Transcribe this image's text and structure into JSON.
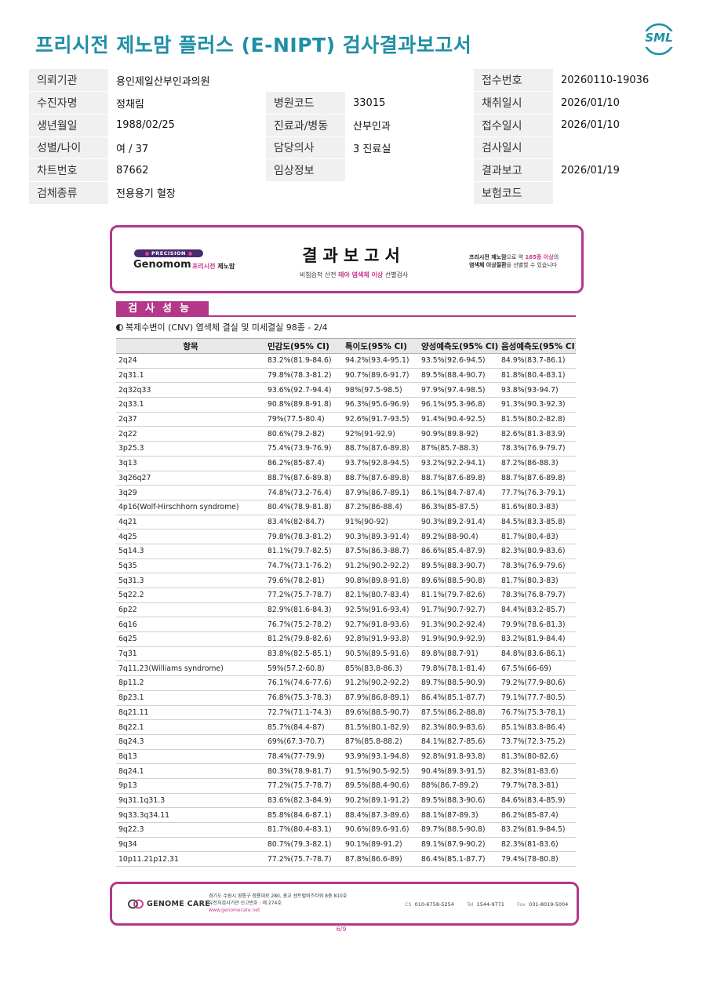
{
  "header": {
    "title": "프리시전 제노맘 플러스 (E-NIPT) 검사결과보고서",
    "logo_text": "SML"
  },
  "patient": {
    "rows": [
      [
        "의뢰기관",
        "용인제일산부인과의원",
        "",
        "",
        "접수번호",
        "20260110-19036"
      ],
      [
        "수진자명",
        "정채림",
        "병원코드",
        "33015",
        "채취일시",
        "2026/01/10"
      ],
      [
        "생년월일",
        "1988/02/25",
        "진료과/병동",
        "산부인과",
        "접수일시",
        "2026/01/10"
      ],
      [
        "성별/나이",
        "여 / 37",
        "담당의사",
        "3 진료실",
        "검사일시",
        ""
      ],
      [
        "차트번호",
        "87662",
        "임상정보",
        "",
        "결과보고",
        "2026/01/19"
      ],
      [
        "검체종류",
        "전용용기 혈장",
        "",
        "",
        "보험코드",
        ""
      ]
    ]
  },
  "report_header": {
    "badge": "PRECISION",
    "brand": "Genomom",
    "brand_sub_pink": "프리시전",
    "brand_sub": "제노맘",
    "title": "결과보고서",
    "subtitle_pre": "비침습적 산전",
    "subtitle_pink": "태아 염색체 이상",
    "subtitle_post": "선별검사",
    "right_line1_bold": "프리시전 제노맘",
    "right_line1_mid": "으로 약",
    "right_line1_pink": "165종 이상",
    "right_line1_post": "의",
    "right_line2_bold": "염색체 이상질환",
    "right_line2_post": "을 선별할 수 있습니다"
  },
  "section": {
    "tag": "검사성능",
    "subtitle": "복제수변이 (CNV) 염색체 결실 및 미세결실 98종 - 2/4"
  },
  "table": {
    "headers": [
      "항목",
      "민감도(95% CI)",
      "특이도(95% CI)",
      "양성예측도(95% CI)",
      "음성예측도(95% CI)"
    ],
    "rows": [
      [
        "2q24",
        "83.2%(81.9-84.6)",
        "94.2%(93.4-95.1)",
        "93.5%(92.6-94.5)",
        "84.9%(83.7-86.1)"
      ],
      [
        "2q31.1",
        "79.8%(78.3-81.2)",
        "90.7%(89.6-91.7)",
        "89.5%(88.4-90.7)",
        "81.8%(80.4-83.1)"
      ],
      [
        "2q32q33",
        "93.6%(92.7-94.4)",
        "98%(97.5-98.5)",
        "97.9%(97.4-98.5)",
        "93.8%(93-94.7)"
      ],
      [
        "2q33.1",
        "90.8%(89.8-91.8)",
        "96.3%(95.6-96.9)",
        "96.1%(95.3-96.8)",
        "91.3%(90.3-92.3)"
      ],
      [
        "2q37",
        "79%(77.5-80.4)",
        "92.6%(91.7-93.5)",
        "91.4%(90.4-92.5)",
        "81.5%(80.2-82.8)"
      ],
      [
        "2q22",
        "80.6%(79.2-82)",
        "92%(91-92.9)",
        "90.9%(89.8-92)",
        "82.6%(81.3-83.9)"
      ],
      [
        "3p25.3",
        "75.4%(73.9-76.9)",
        "88.7%(87.6-89.8)",
        "87%(85.7-88.3)",
        "78.3%(76.9-79.7)"
      ],
      [
        "3q13",
        "86.2%(85-87.4)",
        "93.7%(92.8-94.5)",
        "93.2%(92.2-94.1)",
        "87.2%(86-88.3)"
      ],
      [
        "3q26q27",
        "88.7%(87.6-89.8)",
        "88.7%(87.6-89.8)",
        "88.7%(87.6-89.8)",
        "88.7%(87.6-89.8)"
      ],
      [
        "3q29",
        "74.8%(73.2-76.4)",
        "87.9%(86.7-89.1)",
        "86.1%(84.7-87.4)",
        "77.7%(76.3-79.1)"
      ],
      [
        "4p16(Wolf-Hirschhorn syndrome)",
        "80.4%(78.9-81.8)",
        "87.2%(86-88.4)",
        "86.3%(85-87.5)",
        "81.6%(80.3-83)"
      ],
      [
        "4q21",
        "83.4%(82-84.7)",
        "91%(90-92)",
        "90.3%(89.2-91.4)",
        "84.5%(83.3-85.8)"
      ],
      [
        "4q25",
        "79.8%(78.3-81.2)",
        "90.3%(89.3-91.4)",
        "89.2%(88-90.4)",
        "81.7%(80.4-83)"
      ],
      [
        "5q14.3",
        "81.1%(79.7-82.5)",
        "87.5%(86.3-88.7)",
        "86.6%(85.4-87.9)",
        "82.3%(80.9-83.6)"
      ],
      [
        "5q35",
        "74.7%(73.1-76.2)",
        "91.2%(90.2-92.2)",
        "89.5%(88.3-90.7)",
        "78.3%(76.9-79.6)"
      ],
      [
        "5q31.3",
        "79.6%(78.2-81)",
        "90.8%(89.8-91.8)",
        "89.6%(88.5-90.8)",
        "81.7%(80.3-83)"
      ],
      [
        "5q22.2",
        "77.2%(75.7-78.7)",
        "82.1%(80.7-83.4)",
        "81.1%(79.7-82.6)",
        "78.3%(76.8-79.7)"
      ],
      [
        "6p22",
        "82.9%(81.6-84.3)",
        "92.5%(91.6-93.4)",
        "91.7%(90.7-92.7)",
        "84.4%(83.2-85.7)"
      ],
      [
        "6q16",
        "76.7%(75.2-78.2)",
        "92.7%(91.8-93.6)",
        "91.3%(90.2-92.4)",
        "79.9%(78.6-81.3)"
      ],
      [
        "6q25",
        "81.2%(79.8-82.6)",
        "92.8%(91.9-93.8)",
        "91.9%(90.9-92.9)",
        "83.2%(81.9-84.4)"
      ],
      [
        "7q31",
        "83.8%(82.5-85.1)",
        "90.5%(89.5-91.6)",
        "89.8%(88.7-91)",
        "84.8%(83.6-86.1)"
      ],
      [
        "7q11.23(Williams syndrome)",
        "59%(57.2-60.8)",
        "85%(83.8-86.3)",
        "79.8%(78.1-81.4)",
        "67.5%(66-69)"
      ],
      [
        "8p11.2",
        "76.1%(74.6-77.6)",
        "91.2%(90.2-92.2)",
        "89.7%(88.5-90.9)",
        "79.2%(77.9-80.6)"
      ],
      [
        "8p23.1",
        "76.8%(75.3-78.3)",
        "87.9%(86.8-89.1)",
        "86.4%(85.1-87.7)",
        "79.1%(77.7-80.5)"
      ],
      [
        "8q21.11",
        "72.7%(71.1-74.3)",
        "89.6%(88.5-90.7)",
        "87.5%(86.2-88.8)",
        "76.7%(75.3-78.1)"
      ],
      [
        "8q22.1",
        "85.7%(84.4-87)",
        "81.5%(80.1-82.9)",
        "82.3%(80.9-83.6)",
        "85.1%(83.8-86.4)"
      ],
      [
        "8q24.3",
        "69%(67.3-70.7)",
        "87%(85.8-88.2)",
        "84.1%(82.7-85.6)",
        "73.7%(72.3-75.2)"
      ],
      [
        "8q13",
        "78.4%(77-79.9)",
        "93.9%(93.1-94.8)",
        "92.8%(91.8-93.8)",
        "81.3%(80-82.6)"
      ],
      [
        "8q24.1",
        "80.3%(78.9-81.7)",
        "91.5%(90.5-92.5)",
        "90.4%(89.3-91.5)",
        "82.3%(81-83.6)"
      ],
      [
        "9p13",
        "77.2%(75.7-78.7)",
        "89.5%(88.4-90.6)",
        "88%(86.7-89.2)",
        "79.7%(78.3-81)"
      ],
      [
        "9q31.1q31.3",
        "83.6%(82.3-84.9)",
        "90.2%(89.1-91.2)",
        "89.5%(88.3-90.6)",
        "84.6%(83.4-85.9)"
      ],
      [
        "9q33.3q34.11",
        "85.8%(84.6-87.1)",
        "88.4%(87.3-89.6)",
        "88.1%(87-89.3)",
        "86.2%(85-87.4)"
      ],
      [
        "9q22.3",
        "81.7%(80.4-83.1)",
        "90.6%(89.6-91.6)",
        "89.7%(88.5-90.8)",
        "83.2%(81.9-84.5)"
      ],
      [
        "9q34",
        "80.7%(79.3-82.1)",
        "90.1%(89-91.2)",
        "89.1%(87.9-90.2)",
        "82.3%(81-83.6)"
      ],
      [
        "10p11.21p12.31",
        "77.2%(75.7-78.7)",
        "87.8%(86.6-89)",
        "86.4%(85.1-87.7)",
        "79.4%(78-80.8)"
      ]
    ]
  },
  "footer": {
    "brand": "GENOME CARE",
    "addr1": "경기도 수원시 영통구 청룡대로 280, 광교 센트럴비즈타워 8층 810호",
    "addr2": "유전자검사기관 신고번호 : 제 274호",
    "website": "www.genomecare.net",
    "cs_label": "CS",
    "cs": "010-6758-5254",
    "tel_label": "Tel",
    "tel": "1544-9771",
    "fax_label": "Fax",
    "fax": "031-8019-5004"
  },
  "page_number": "6/9",
  "colors": {
    "title": "#1f8fa6",
    "accent": "#b3388a",
    "pink": "#c8368a"
  }
}
